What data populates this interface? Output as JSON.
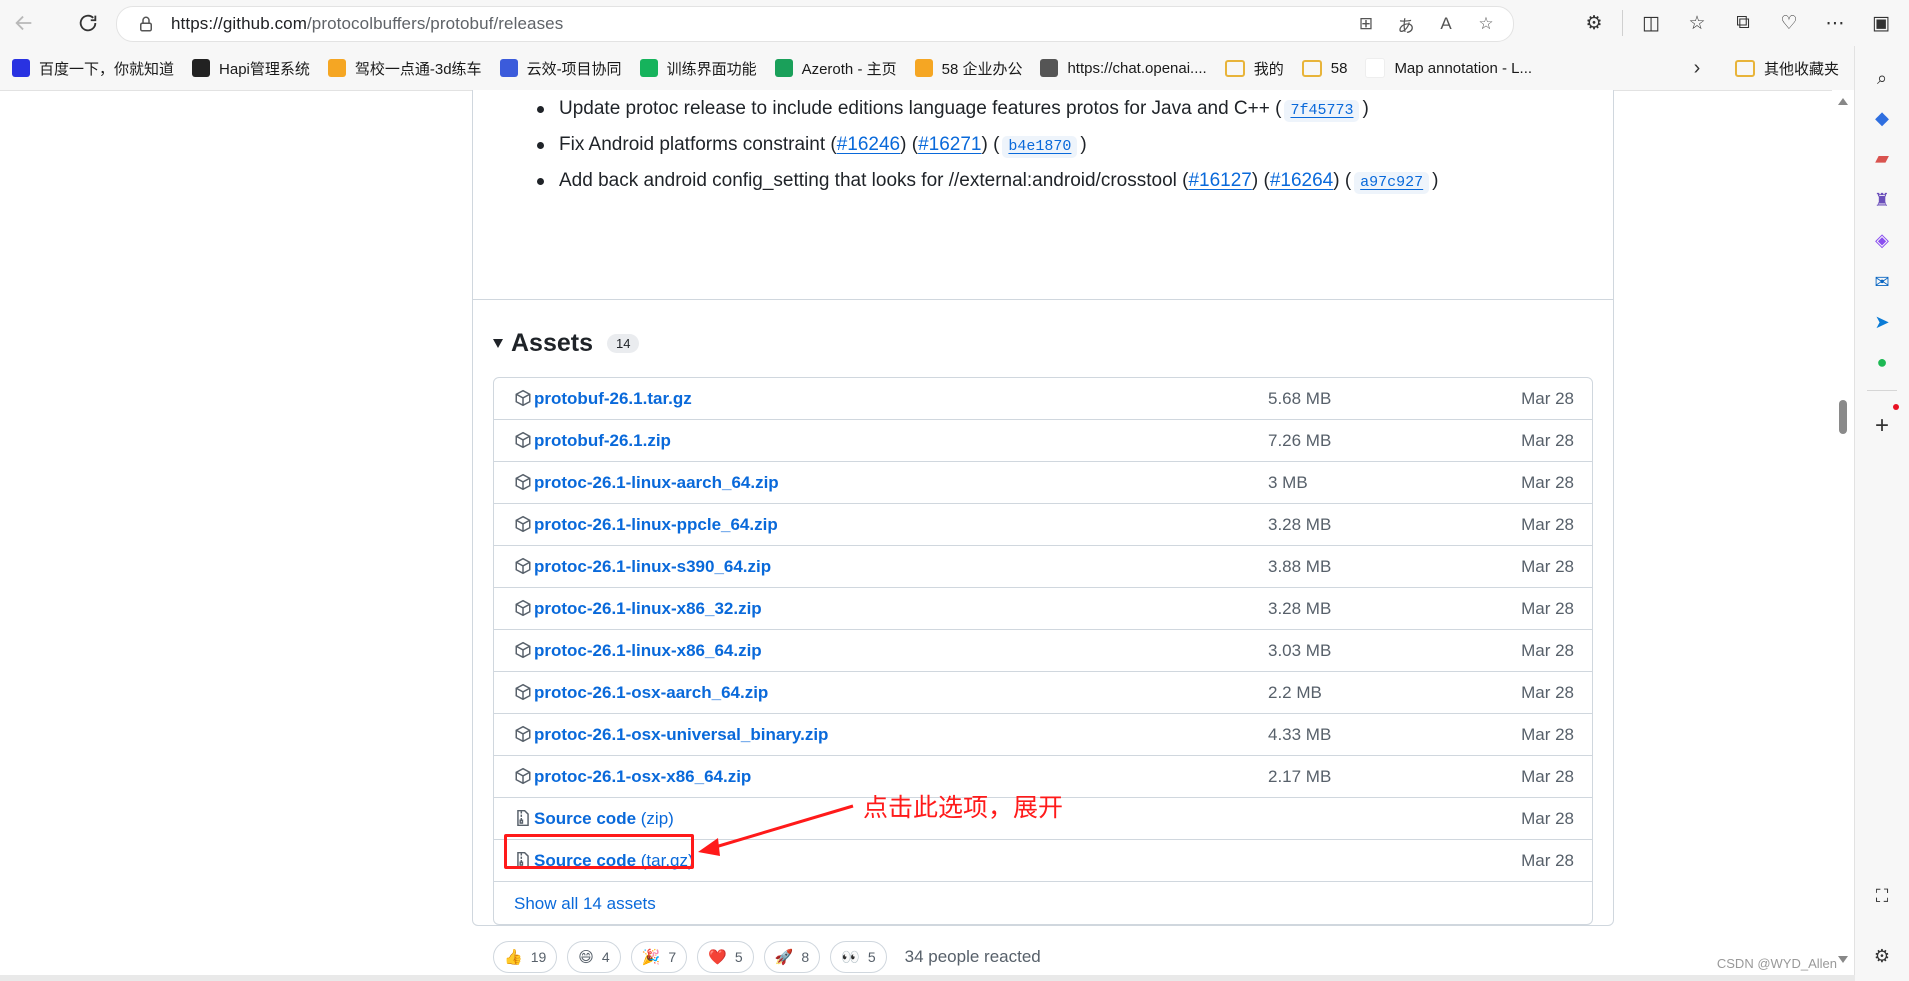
{
  "browser": {
    "url_host": "https://github.com",
    "url_path": "/protocolbuffers/protobuf/releases"
  },
  "bookmarks": [
    {
      "label": "百度一下，你就知道",
      "icon": "baidu-icon",
      "color": "#2932e1"
    },
    {
      "label": "Hapi管理系统",
      "icon": "hapi-icon",
      "color": "#222222"
    },
    {
      "label": "驾校一点通-3d练车",
      "icon": "58-icon",
      "color": "#f5a623"
    },
    {
      "label": "云效-项目协同",
      "icon": "yunxiao-icon",
      "color": "#3b5bdb"
    },
    {
      "label": "训练界面功能",
      "icon": "play-icon",
      "color": "#16b35c"
    },
    {
      "label": "Azeroth - 主页",
      "icon": "h-icon",
      "color": "#1aa05a"
    },
    {
      "label": "58 企业办公",
      "icon": "58-icon",
      "color": "#f5a623"
    },
    {
      "label": "https://chat.openai....",
      "icon": "openai-icon",
      "color": "#555555"
    },
    {
      "label": "我的",
      "icon": "folder-icon",
      "color": "#e8b43a"
    },
    {
      "label": "58",
      "icon": "folder-icon",
      "color": "#e8b43a"
    },
    {
      "label": "Map annotation - L...",
      "icon": "blank-icon",
      "color": "#ffffff"
    }
  ],
  "bookmarks_other": "其他收藏夹",
  "release_notes": {
    "items": [
      {
        "text": "Update protoc release to include editions language features protos for Java and C++ (",
        "links": [],
        "sha": "7f45773",
        "end": ")"
      },
      {
        "text": "Fix Android platforms constraint (",
        "links": [
          "#16246",
          "#16271"
        ],
        "sha": "b4e1870",
        "end": ")"
      },
      {
        "text": "Add back android config_setting that looks for //external:android/crosstool (",
        "links": [
          "#16127",
          "#16264"
        ],
        "sha": "a97c927",
        "end": ")"
      }
    ]
  },
  "assets": {
    "title": "Assets",
    "count": "14",
    "rows": [
      {
        "name": "protobuf-26.1.tar.gz",
        "suffix": "",
        "size": "5.68 MB",
        "date": "Mar 28",
        "icon": "package-icon"
      },
      {
        "name": "protobuf-26.1.zip",
        "suffix": "",
        "size": "7.26 MB",
        "date": "Mar 28",
        "icon": "package-icon"
      },
      {
        "name": "protoc-26.1-linux-aarch_64.zip",
        "suffix": "",
        "size": "3 MB",
        "date": "Mar 28",
        "icon": "package-icon"
      },
      {
        "name": "protoc-26.1-linux-ppcle_64.zip",
        "suffix": "",
        "size": "3.28 MB",
        "date": "Mar 28",
        "icon": "package-icon"
      },
      {
        "name": "protoc-26.1-linux-s390_64.zip",
        "suffix": "",
        "size": "3.88 MB",
        "date": "Mar 28",
        "icon": "package-icon"
      },
      {
        "name": "protoc-26.1-linux-x86_32.zip",
        "suffix": "",
        "size": "3.28 MB",
        "date": "Mar 28",
        "icon": "package-icon"
      },
      {
        "name": "protoc-26.1-linux-x86_64.zip",
        "suffix": "",
        "size": "3.03 MB",
        "date": "Mar 28",
        "icon": "package-icon"
      },
      {
        "name": "protoc-26.1-osx-aarch_64.zip",
        "suffix": "",
        "size": "2.2 MB",
        "date": "Mar 28",
        "icon": "package-icon"
      },
      {
        "name": "protoc-26.1-osx-universal_binary.zip",
        "suffix": "",
        "size": "4.33 MB",
        "date": "Mar 28",
        "icon": "package-icon"
      },
      {
        "name": "protoc-26.1-osx-x86_64.zip",
        "suffix": "",
        "size": "2.17 MB",
        "date": "Mar 28",
        "icon": "package-icon"
      },
      {
        "name": "Source code",
        "suffix": " (zip)",
        "size": "",
        "date": "Mar 28",
        "icon": "file-zip-icon"
      },
      {
        "name": "Source code",
        "suffix": " (tar.gz)",
        "size": "",
        "date": "Mar 28",
        "icon": "file-zip-icon"
      }
    ],
    "show_all": "Show all 14 assets"
  },
  "annotation": {
    "text": "点击此选项，展开",
    "color": "#ff1a1a"
  },
  "reactions": {
    "items": [
      {
        "emoji": "👍",
        "count": "19"
      },
      {
        "emoji": "😄",
        "count": "4"
      },
      {
        "emoji": "🎉",
        "count": "7"
      },
      {
        "emoji": "❤️",
        "count": "5"
      },
      {
        "emoji": "🚀",
        "count": "8"
      },
      {
        "emoji": "👀",
        "count": "5"
      }
    ],
    "summary": "34 people reacted"
  },
  "watermark": "CSDN @WYD_Allen",
  "colors": {
    "link": "#0969da",
    "muted": "#57606a",
    "border": "#d0d7de"
  }
}
